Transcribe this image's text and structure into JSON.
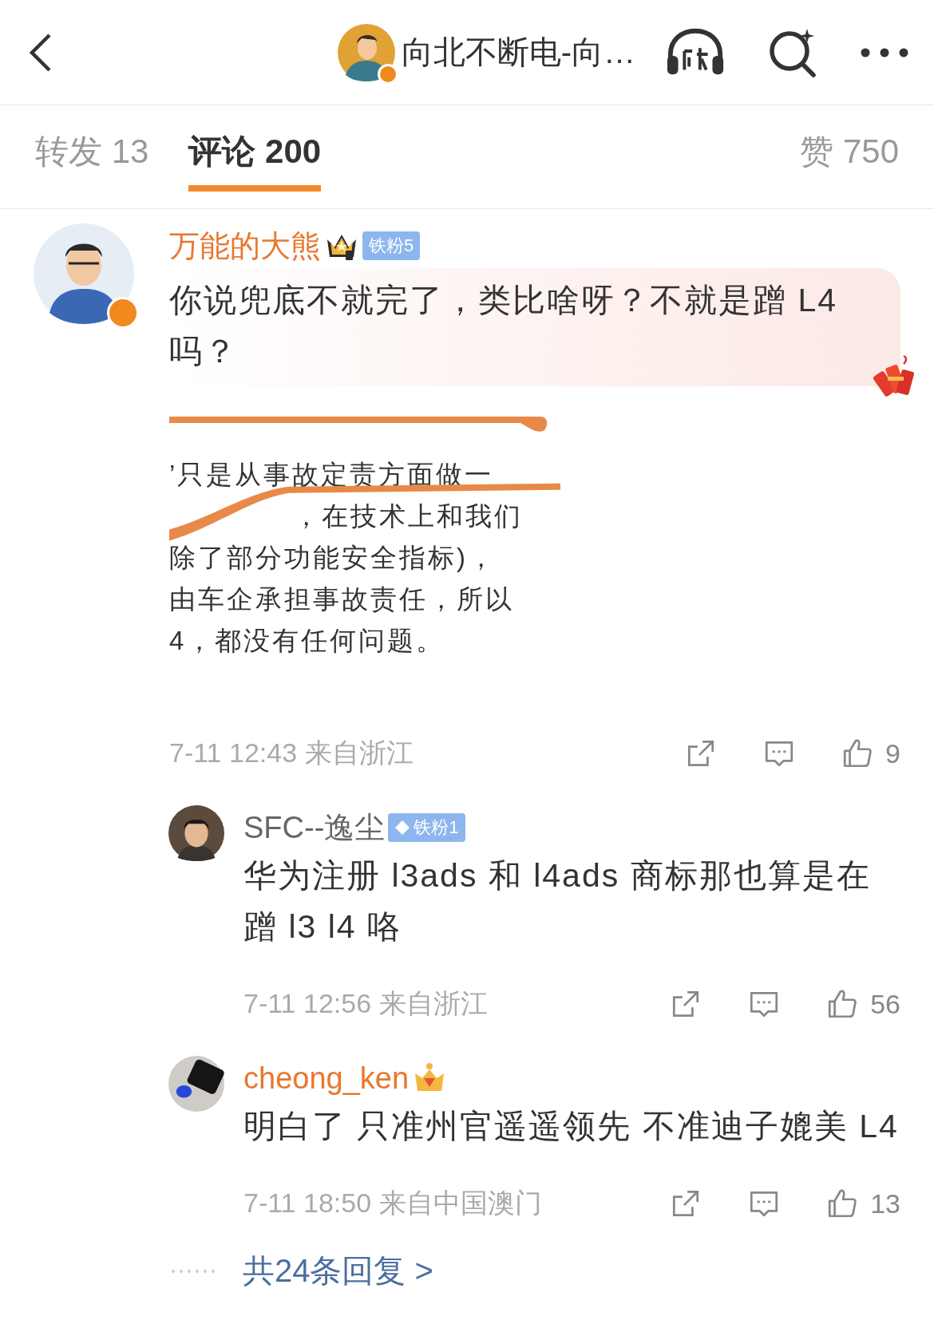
{
  "header": {
    "title": "向北不断电-向…",
    "verified": true
  },
  "tabs": [
    {
      "label": "转发 13",
      "selected": false
    },
    {
      "label": "评论 200",
      "selected": true
    },
    {
      "label": "赞 750",
      "selected": false
    }
  ],
  "comments": [
    {
      "author": "万能的大熊",
      "vip": true,
      "verified": true,
      "decorated": true,
      "badges": [
        {
          "kind": "crown"
        },
        {
          "kind": "fan",
          "label": "铁粉5"
        }
      ],
      "text": "你说兜底不就完了，类比啥呀？不就是蹭 L4 吗？",
      "attachment": {
        "lines": [
          {
            "text": "’只是从事故定责方面做一",
            "struck": false
          },
          {
            "text": "，在技术上和我们",
            "struck": true
          },
          {
            "text": "除了部分功能安全指标)，",
            "struck": false
          },
          {
            "text": "由车企承担事故责任，所以",
            "struck": false
          },
          {
            "text": "4，都没有任何问题。",
            "struck": false
          }
        ]
      },
      "time": "7-11 12:43",
      "location": "来自浙江",
      "likes": "9",
      "replies": [
        {
          "author": "SFC--逸尘",
          "vip": false,
          "badges": [
            {
              "kind": "fan-diamond",
              "label": "铁粉1"
            }
          ],
          "text": "华为注册 l3ads 和 l4ads 商标那也算是在蹭 l3 l4 咯",
          "time": "7-11 12:56",
          "location": "来自浙江",
          "likes": "56"
        },
        {
          "author": "cheong_ken",
          "vip": true,
          "badges": [
            {
              "kind": "crown-gem"
            }
          ],
          "text": "明白了 只准州官遥遥领先 不准迪子媲美 L4",
          "time": "7-11 18:50",
          "location": "来自中国澳门",
          "likes": "13"
        }
      ],
      "more_replies": "共24条回复 >"
    }
  ]
}
